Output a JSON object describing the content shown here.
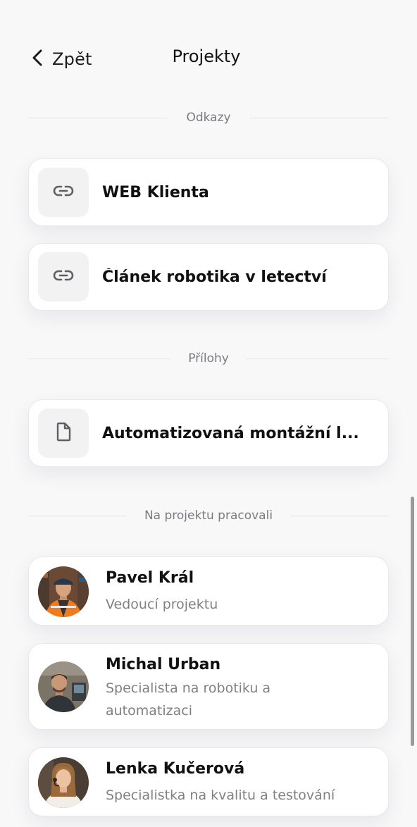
{
  "header": {
    "back_label": "Zpět",
    "title": "Projekty"
  },
  "sections": {
    "links": {
      "label": "Odkazy",
      "items": [
        {
          "label": "WEB Klienta",
          "icon": "link-icon"
        },
        {
          "label": "Článek robotika v letectví",
          "icon": "link-icon"
        }
      ]
    },
    "attachments": {
      "label": "Přílohy",
      "items": [
        {
          "label": "Automatizovaná montážní l...",
          "icon": "file-icon"
        }
      ]
    },
    "team": {
      "label": "Na projektu pracovali",
      "members": [
        {
          "name": "Pavel Král",
          "role": "Vedoucí projektu"
        },
        {
          "name": "Michal Urban",
          "role": "Specialista na robotiku a automatizaci"
        },
        {
          "name": "Lenka Kučerová",
          "role": "Specialistka na kvalitu a testování"
        }
      ]
    }
  },
  "colors": {
    "background": "#f8f8f9",
    "card": "#ffffff",
    "icon_box": "#f2f2f3",
    "muted_text": "#808085"
  }
}
